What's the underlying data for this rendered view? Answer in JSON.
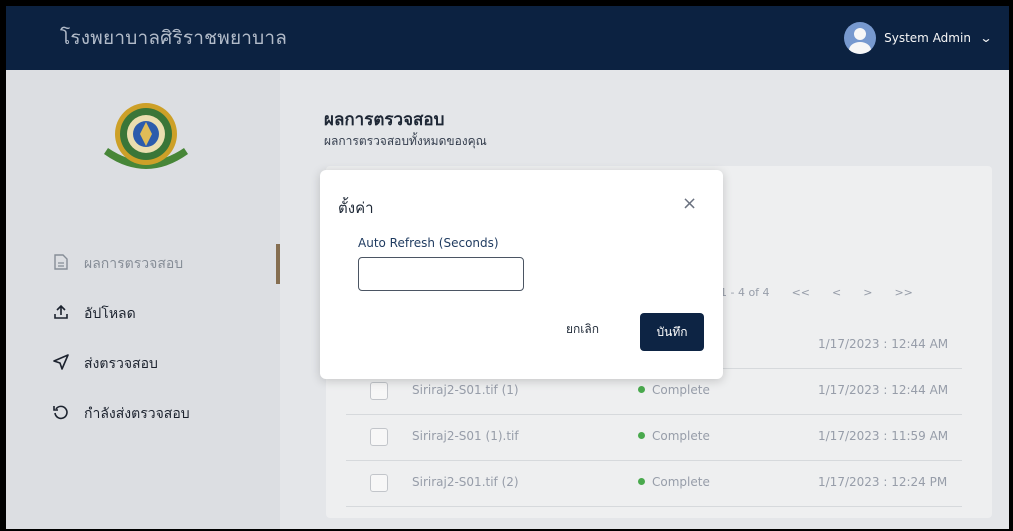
{
  "header": {
    "app_title": "โรงพยาบาลศิริราชพยาบาล",
    "user_name": "System Admin"
  },
  "sidebar": {
    "items": [
      {
        "label": "ผลการตรวจสอบ",
        "icon": "document-icon"
      },
      {
        "label": "อัปโหลด",
        "icon": "upload-icon"
      },
      {
        "label": "ส่งตรวจสอบ",
        "icon": "send-icon"
      },
      {
        "label": "กำลังส่งตรวจสอบ",
        "icon": "refresh-icon"
      }
    ]
  },
  "main": {
    "title": "ผลการตรวจสอบ",
    "subtitle": "ผลการตรวจสอบทั้งหมดของคุณ",
    "pagination": {
      "range": "1 - 4 of 4",
      "first": "<<",
      "prev": "<",
      "next": ">",
      "last": ">>"
    },
    "rows": [
      {
        "name": "",
        "status": "",
        "date": "1/17/2023 : 12:44 AM"
      },
      {
        "name": "Siriraj2-S01.tif (1)",
        "status": "Complete",
        "date": "1/17/2023 : 12:44 AM"
      },
      {
        "name": "Siriraj2-S01 (1).tif",
        "status": "Complete",
        "date": "1/17/2023 : 11:59 AM"
      },
      {
        "name": "Siriraj2-S01.tif (2)",
        "status": "Complete",
        "date": "1/17/2023 : 12:24 PM"
      }
    ]
  },
  "modal": {
    "title": "ตั้งค่า",
    "close": "×",
    "field_label": "Auto Refresh (Seconds)",
    "field_value": "",
    "cancel_label": "ยกเลิก",
    "save_label": "บันทึก"
  },
  "colors": {
    "navy": "#0d2444",
    "accent": "#8a7254",
    "complete": "#4caf50"
  }
}
